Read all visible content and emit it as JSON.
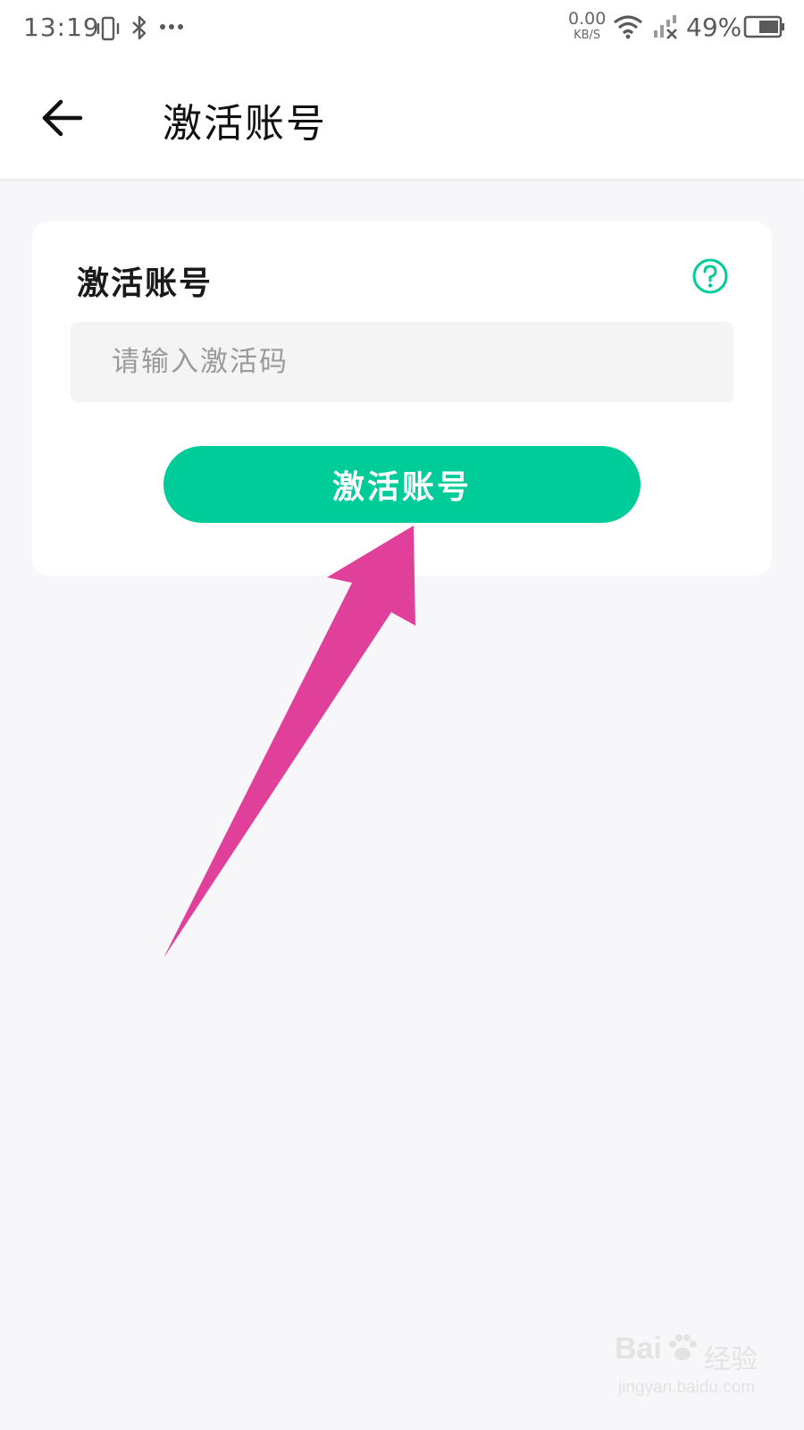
{
  "status_bar": {
    "time": "13:19",
    "net_speed_value": "0.00",
    "net_speed_unit": "KB/S",
    "battery_percent": "49%",
    "icons": [
      "vibrate-icon",
      "bluetooth-icon",
      "more-icon",
      "wifi-icon",
      "signal-icon",
      "battery-icon"
    ]
  },
  "header": {
    "title": "激活账号",
    "back_icon": "arrow-left-icon"
  },
  "card": {
    "title": "激活账号",
    "help_icon": "question-circle-icon",
    "input_placeholder": "请输入激活码",
    "input_value": "",
    "button_label": "激活账号"
  },
  "annotation": {
    "arrow_color": "#e0409a"
  },
  "watermark": {
    "logo": "Bai",
    "brand": "经验",
    "url": "jingyan.baidu.com"
  },
  "colors": {
    "accent": "#00cc99",
    "background": "#f7f7fa",
    "card": "#ffffff"
  }
}
